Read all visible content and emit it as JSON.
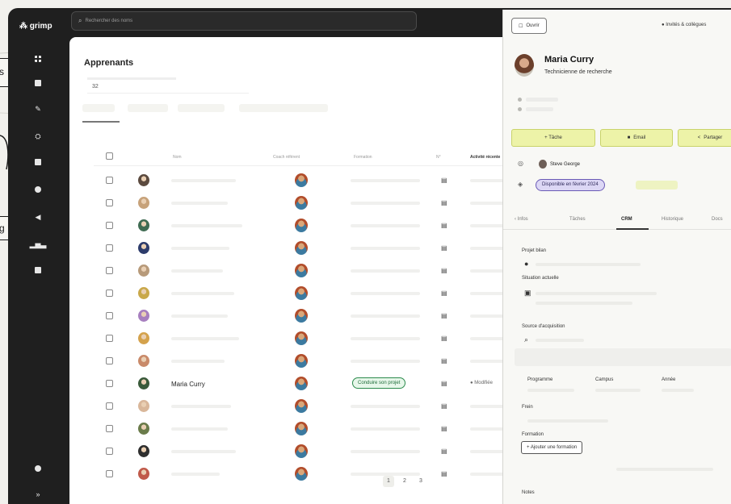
{
  "sketch": {
    "labels": [
      "s",
      "g"
    ]
  },
  "app": {
    "logo": "grimp",
    "search": {
      "icon": "search-icon",
      "placeholder": "Rechercher des noms"
    },
    "rail": [
      "grid-icon",
      "document-icon",
      "chart-icon",
      "users-icon",
      "calendar-icon",
      "settings-icon",
      "megaphone-icon",
      "stats-icon",
      "table-icon",
      "help-icon",
      "expand-icon"
    ]
  },
  "main": {
    "title": "Apprenants",
    "filter_value": "32",
    "columns": [
      "Nom",
      "Coach référent",
      "Formation",
      "N°",
      "Activité récente"
    ],
    "highlight_row": {
      "name": "Maria Curry",
      "status": "Conduire son projet",
      "activity": "Modifiée"
    },
    "pager": [
      "1",
      "2",
      "3"
    ]
  },
  "panel": {
    "top_button": "Ouvrir",
    "top_right": "Invités & collègues",
    "user": {
      "name": "Maria Curry",
      "role": "Technicienne de recherche"
    },
    "actions": [
      "+ Tâche",
      "Email",
      "Partager"
    ],
    "owner": "Steve George",
    "availability": "Disponible en février 2024",
    "tabs": [
      "Infos",
      "Tâches",
      "CRM",
      "Historique",
      "Docs"
    ],
    "active_tab": "CRM",
    "fields": {
      "project": "Projet bilan",
      "situation": "Situation actuelle",
      "source": "Source d'acquisition",
      "program": "Programme",
      "company": "Campus",
      "year": "Année",
      "need": "Frein",
      "formation": "Formation",
      "add_formation": "+ Ajouter une formation",
      "notes": "Notes"
    }
  }
}
